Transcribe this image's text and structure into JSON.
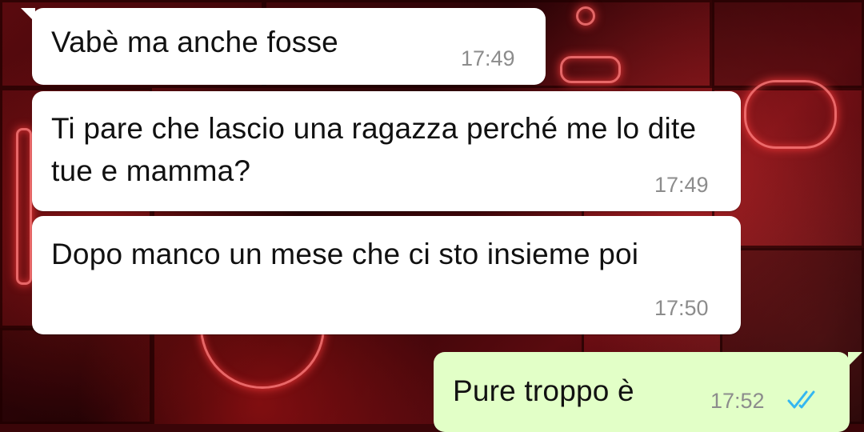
{
  "messages": [
    {
      "direction": "incoming",
      "text": "Vabè ma anche fosse",
      "time": "17:49"
    },
    {
      "direction": "incoming",
      "text": "Ti pare che lascio una ragazza perché me lo dite tue e mamma?",
      "time": "17:49"
    },
    {
      "direction": "incoming",
      "text": "Dopo manco un mese che ci sto insieme poi",
      "time": "17:50"
    },
    {
      "direction": "outgoing",
      "text": "Pure troppo è",
      "time": "17:52",
      "status_icon": "double-check-read-icon"
    }
  ],
  "colors": {
    "incoming_bubble": "#ffffff",
    "outgoing_bubble": "#e2ffc7",
    "timestamp": "#8c8c8c",
    "read_ticks": "#34b7f1",
    "wallpaper_accent": "#c8101a"
  }
}
